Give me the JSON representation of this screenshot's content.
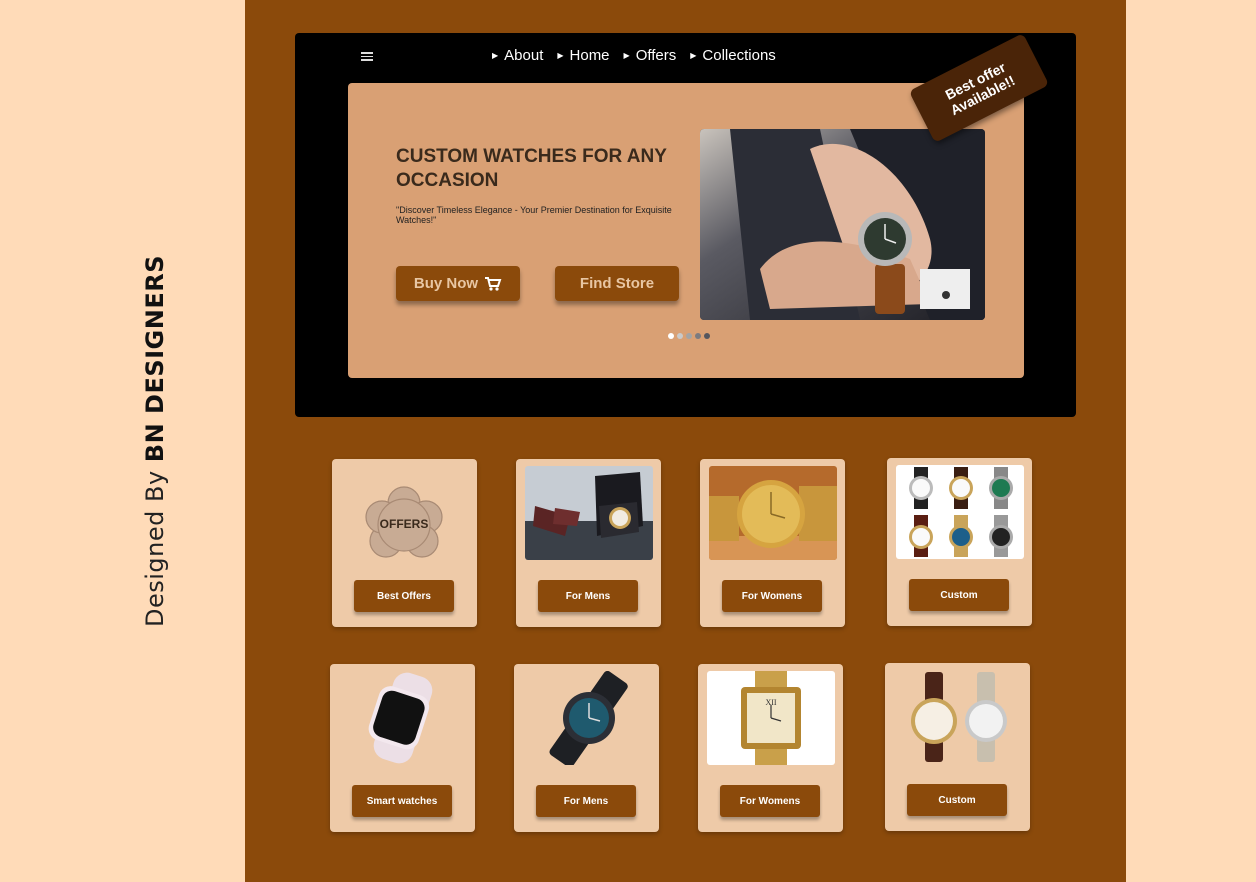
{
  "credit": {
    "prefix": "Designed By",
    "name": "BN DESIGNERS"
  },
  "nav": [
    "About",
    "Home",
    "Offers",
    "Collections"
  ],
  "hero": {
    "title": "CUSTOM WATCHES FOR ANY OCCASION",
    "subtitle": "\"Discover Timeless Elegance - Your Premier Destination for Exquisite Watches!\"",
    "buy_label": "Buy Now",
    "store_label": "Find Store",
    "ribbon_line1": "Best offer",
    "ribbon_line2": "Available!!",
    "carousel": {
      "slides": 5,
      "active": 1
    }
  },
  "offers_badge": "OFFERS",
  "cards_row1": [
    "Best Offers",
    "For Mens",
    "For Womens",
    "Custom"
  ],
  "cards_row2": [
    "Smart watches",
    "For Mens",
    "For Womens",
    "Custom"
  ],
  "colors": {
    "background": "#ffdbb8",
    "panel": "#8b4a0b",
    "hero": "#d9a074",
    "card": "#eecaa8",
    "button": "#8b4a0b",
    "ribbon": "#4a2408"
  }
}
